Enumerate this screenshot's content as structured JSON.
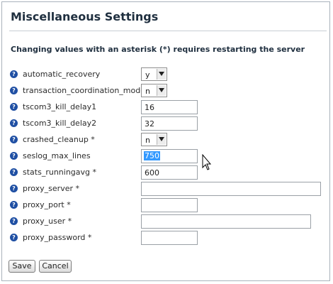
{
  "title": "Miscellaneous Settings",
  "notice": "Changing values with an asterisk (*) requires restarting the server",
  "help_glyph": "?",
  "fields": [
    {
      "label": "automatic_recovery",
      "type": "select",
      "value": "y"
    },
    {
      "label": "transaction_coordination_mode *",
      "type": "select",
      "value": "n"
    },
    {
      "label": "tscom3_kill_delay1",
      "type": "text",
      "value": "16"
    },
    {
      "label": "tscom3_kill_delay2",
      "type": "text",
      "value": "32"
    },
    {
      "label": "crashed_cleanup *",
      "type": "select",
      "value": "n"
    },
    {
      "label": "seslog_max_lines",
      "type": "text",
      "value": "750",
      "selected": true
    },
    {
      "label": "stats_runningavg *",
      "type": "text",
      "value": "600"
    },
    {
      "label": "proxy_server *",
      "type": "text",
      "value": ""
    },
    {
      "label": "proxy_port *",
      "type": "text",
      "value": ""
    },
    {
      "label": "proxy_user *",
      "type": "text",
      "value": ""
    },
    {
      "label": "proxy_password *",
      "type": "text",
      "value": ""
    }
  ],
  "buttons": {
    "save": "Save",
    "cancel": "Cancel"
  },
  "icons": {
    "help": "help-icon",
    "dropdown": "chevron-down-icon",
    "cursor": "text-cursor-icon"
  },
  "colors": {
    "help_icon": "#1f4fa3",
    "selection": "#3399ff"
  }
}
